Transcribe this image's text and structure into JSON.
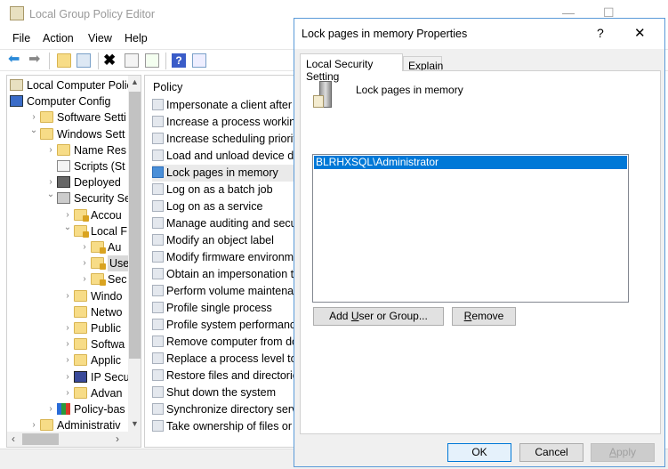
{
  "app": {
    "title": "Local Group Policy Editor",
    "minimize": "—",
    "maximize": "☐",
    "close": "✕"
  },
  "menu": [
    "File",
    "Action",
    "View",
    "Help"
  ],
  "toolbar": [
    "back-icon",
    "forward-icon",
    "up-folder-icon",
    "show-hide-tree-icon",
    "delete-icon",
    "properties-icon",
    "export-list-icon",
    "help-icon",
    "show-action-pane-icon"
  ],
  "tree": [
    {
      "label": "Local Computer Polic",
      "level": 0,
      "state": "none",
      "icon": "policy"
    },
    {
      "label": "Computer Config",
      "level": 0,
      "state": "open",
      "icon": "computer"
    },
    {
      "label": "Software Setti",
      "level": 1,
      "state": "closed",
      "icon": "folder"
    },
    {
      "label": "Windows Sett",
      "level": 1,
      "state": "open",
      "icon": "folder"
    },
    {
      "label": "Name Res",
      "level": 2,
      "state": "closed",
      "icon": "folder"
    },
    {
      "label": "Scripts (St",
      "level": 2,
      "state": "none",
      "icon": "script"
    },
    {
      "label": "Deployed",
      "level": 2,
      "state": "closed",
      "icon": "printer"
    },
    {
      "label": "Security Se",
      "level": 2,
      "state": "open",
      "icon": "security"
    },
    {
      "label": "Accou",
      "level": 3,
      "state": "closed",
      "icon": "lockfolder"
    },
    {
      "label": "Local F",
      "level": 3,
      "state": "open",
      "icon": "lockfolder"
    },
    {
      "label": "Au",
      "level": 4,
      "state": "closed",
      "icon": "lockfolder"
    },
    {
      "label": "Use",
      "level": 4,
      "state": "closed",
      "icon": "lockfolder",
      "selected": true
    },
    {
      "label": "Sec",
      "level": 4,
      "state": "closed",
      "icon": "lockfolder"
    },
    {
      "label": "Windo",
      "level": 3,
      "state": "closed",
      "icon": "folder"
    },
    {
      "label": "Netwo",
      "level": 3,
      "state": "none",
      "icon": "folder"
    },
    {
      "label": "Public",
      "level": 3,
      "state": "closed",
      "icon": "folder"
    },
    {
      "label": "Softwa",
      "level": 3,
      "state": "closed",
      "icon": "folder"
    },
    {
      "label": "Applic",
      "level": 3,
      "state": "closed",
      "icon": "folder"
    },
    {
      "label": "IP Secu",
      "level": 3,
      "state": "closed",
      "icon": "ipsec"
    },
    {
      "label": "Advan",
      "level": 3,
      "state": "closed",
      "icon": "folder"
    },
    {
      "label": "Policy-bas",
      "level": 2,
      "state": "closed",
      "icon": "chart"
    },
    {
      "label": "Administrativ",
      "level": 1,
      "state": "closed",
      "icon": "folder"
    }
  ],
  "policy": {
    "header": "Policy",
    "items": [
      "Impersonate a client after a",
      "Increase a process working",
      "Increase scheduling priority",
      "Load and unload device dri",
      "Lock pages in memory",
      "Log on as a batch job",
      "Log on as a service",
      "Manage auditing and secu",
      "Modify an object label",
      "Modify firmware environm",
      "Obtain an impersonation to",
      "Perform volume maintenar",
      "Profile single process",
      "Profile system performance",
      "Remove computer from do",
      "Replace a process level toke",
      "Restore files and directories",
      "Shut down the system",
      "Synchronize directory servi",
      "Take ownership of files or o"
    ],
    "selected_index": 4
  },
  "dialog": {
    "title": "Lock pages in memory Properties",
    "help": "?",
    "close": "✕",
    "tabs": [
      "Local Security Setting",
      "Explain"
    ],
    "active_tab": 0,
    "policy_name": "Lock pages in memory",
    "members": [
      "BLRHXSQL\\Administrator"
    ],
    "add_pre": "Add ",
    "add_u": "U",
    "add_post": "ser or Group...",
    "remove_u": "R",
    "remove_post": "emove",
    "ok": "OK",
    "cancel": "Cancel",
    "apply_u": "A",
    "apply_post": "pply"
  },
  "colors": {
    "selection": "#0078d7",
    "dialog_border": "#5a9ad8"
  }
}
